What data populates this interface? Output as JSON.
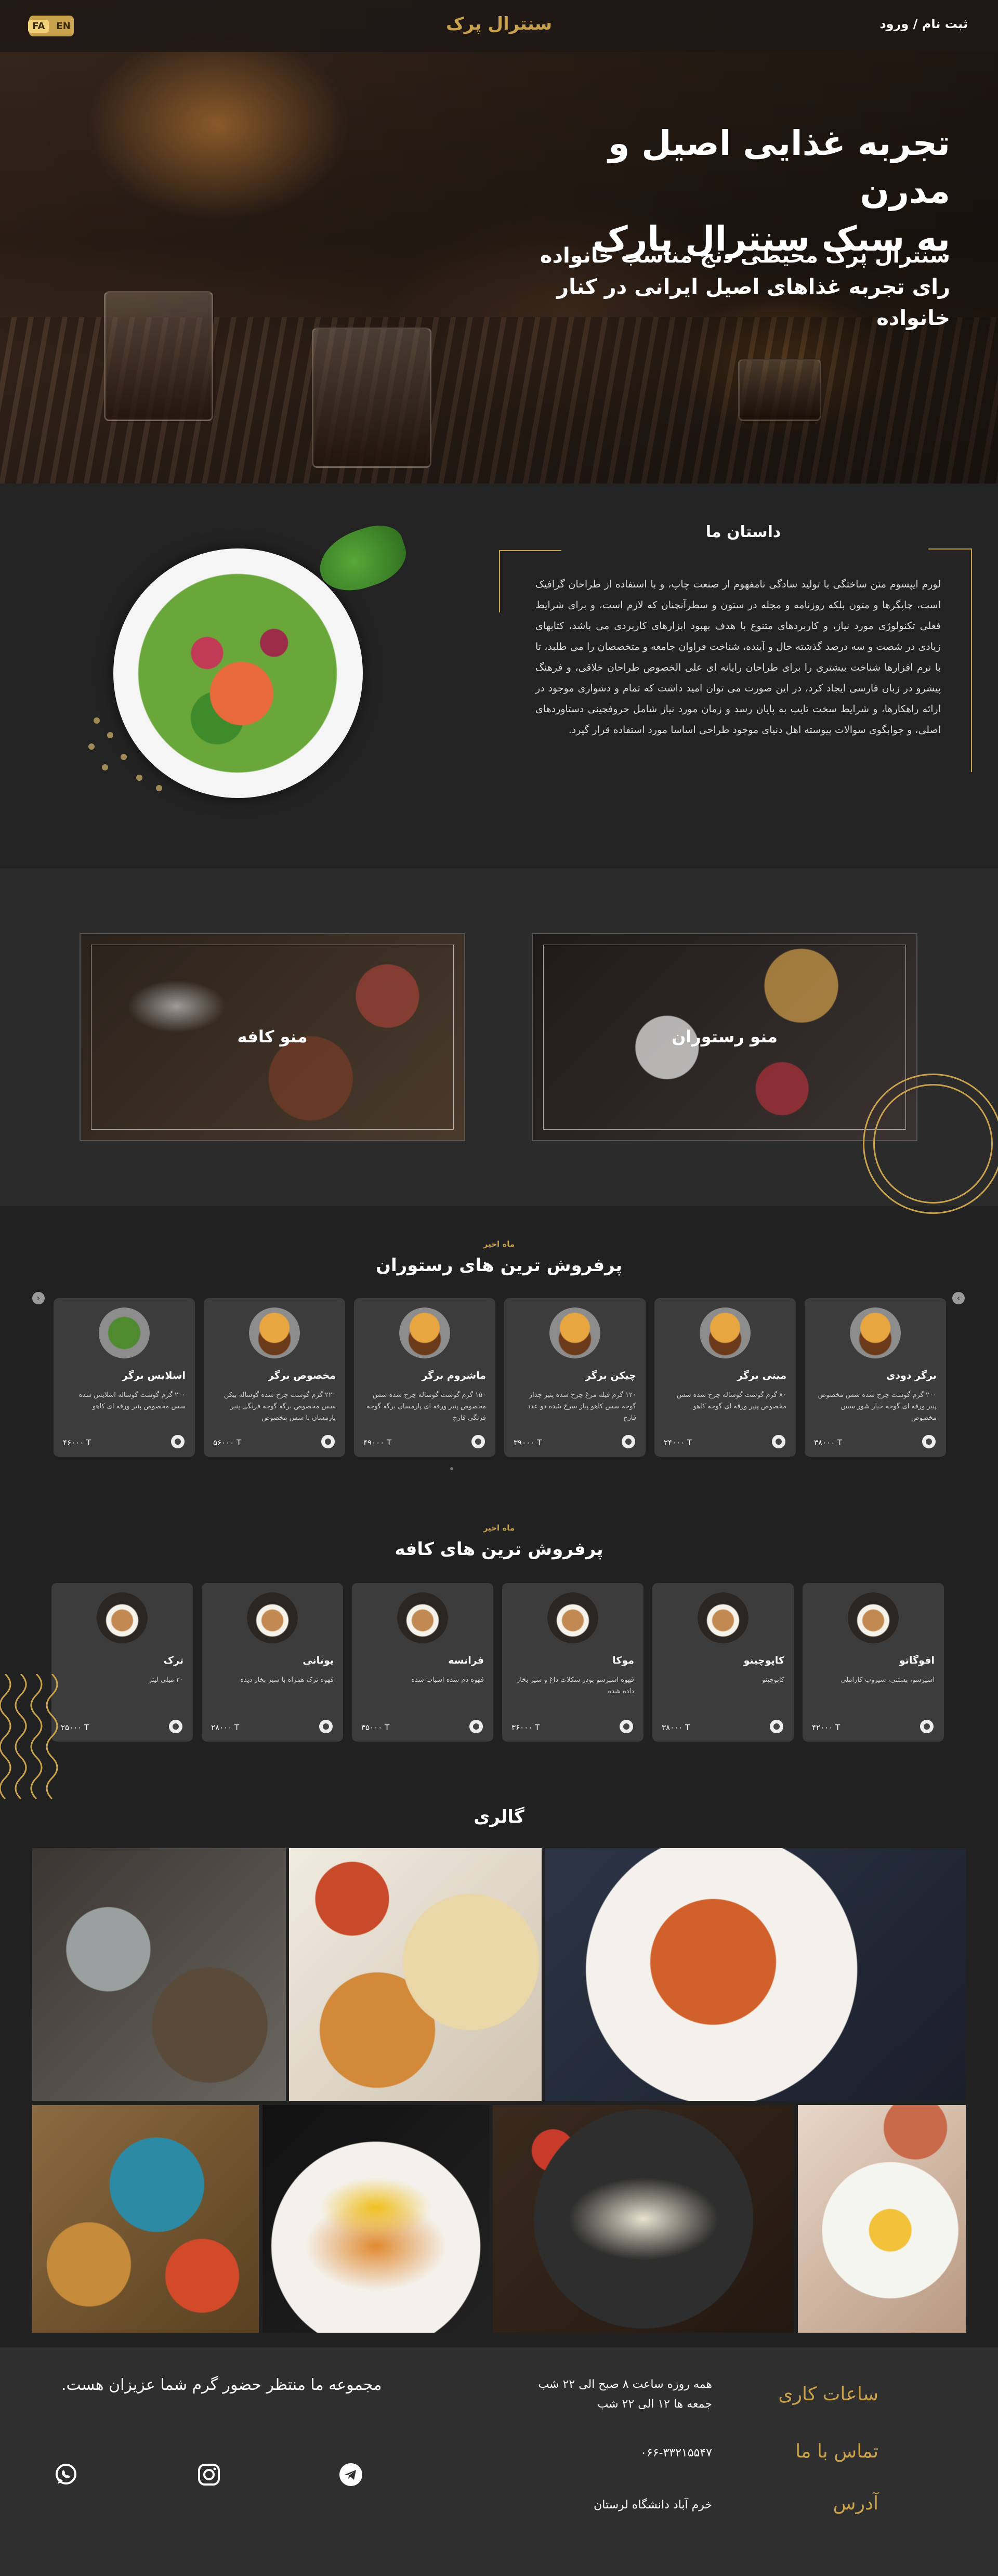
{
  "header": {
    "brand": "سنترال پرک",
    "auth_link": "ثبت نام / ورود",
    "lang_fa": "FA",
    "lang_en": "EN"
  },
  "hero": {
    "title_line1": "تجربه غذایی اصیل و مدرن",
    "title_line2": "به سبک سنترال پارک",
    "subtitle_line1": "سنترال پرک محیطی دنج مناسب خانواده",
    "subtitle_line2": "رای تجربه غذاهای اصیل ایرانی در کنار خانواده"
  },
  "story": {
    "title": "داستان ما",
    "text": "لورم ایپسوم متن ساختگی با تولید سادگی نامفهوم از صنعت چاپ، و با استفاده از طراحان گرافیک است، چاپگرها و متون بلکه روزنامه و مجله در ستون و سطرآنچنان که لازم است، و برای شرایط فعلی تکنولوژی مورد نیاز، و کاربردهای متنوع با هدف بهبود ابزارهای کاربردی می باشد، کتابهای زیادی در شصت و سه درصد گذشته حال و آینده، شناخت فراوان جامعه و متخصصان را می طلبد، تا با نرم افزارها شناخت بیشتری را برای طراحان رایانه ای علی الخصوص طراحان خلاقی، و فرهنگ پیشرو در زبان فارسی ایجاد کرد، در این صورت می توان امید داشت که تمام و دشواری موجود در ارائه راهکارها، و شرایط سخت تایپ به پایان رسد و زمان مورد نیاز شامل حروفچینی دستاوردهای اصلی، و جوابگوی سوالات پیوسته اهل دنیای موجود طراحی اساسا مورد استفاده قرار گیرد."
  },
  "menus": {
    "restaurant": "منو رستوران",
    "cafe": "منو کافه"
  },
  "restaurant_section": {
    "eyebrow": "ماه اخیر",
    "title": "پرفروش ترین های رستوران",
    "items": [
      {
        "name": "برگر دودی",
        "desc": "۲۰۰ گرم گوشت چرخ شده سس مخصوص پنیر ورقه ای گوجه خیار شور سس مخصوص",
        "price": "۳۸۰۰۰ T"
      },
      {
        "name": "مینی برگر",
        "desc": "۸۰ گرم گوشت گوساله چرخ شده سس مخصوص پنیر ورقه ای گوجه کاهو",
        "price": "۲۴۰۰۰ T"
      },
      {
        "name": "چیکن برگر",
        "desc": "۱۲۰ گرم فیله مرغ چرخ شده پنیر چدار گوجه سس کاهو پیاز سرخ شده دو عدد قارچ",
        "price": "۳۹۰۰۰ T"
      },
      {
        "name": "ماشروم برگر",
        "desc": "۱۵۰ گرم گوشت گوساله چرخ شده سس مخصوص پنیر ورقه ای پارمسان برگه گوجه فرنگی قارچ",
        "price": "۴۹۰۰۰ T"
      },
      {
        "name": "مخصوص برگر",
        "desc": "۲۲۰ گرم گوشت چرخ شده گوساله بیکن سس مخصوص برگه گوجه فرنگی پنیر پارمسان با سس مخصوص",
        "price": "۵۶۰۰۰ T"
      },
      {
        "name": "اسلایس برگر",
        "desc": "۲۰۰ گرم گوشت گوساله اسلایس شده سس مخصوص پنیر ورقه ای کاهو",
        "price": "۴۶۰۰۰ T"
      }
    ]
  },
  "cafe_section": {
    "eyebrow": "ماه اخیر",
    "title": "پرفروش ترین های کافه",
    "items": [
      {
        "name": "افوگاتو",
        "desc": "اسپرسو، بستنی، سیروپ کاراملی",
        "price": "۴۲۰۰۰ T"
      },
      {
        "name": "کاپوچینو",
        "desc": "کاپوچینو",
        "price": "۳۸۰۰۰ T"
      },
      {
        "name": "موکا",
        "desc": "قهوه اسپرسو پودر شکلات داغ و شیر بخار داده شده",
        "price": "۳۶۰۰۰ T"
      },
      {
        "name": "فرانسه",
        "desc": "قهوه دم شده اسیاب شده",
        "price": "۳۵۰۰۰ T"
      },
      {
        "name": "یونانی",
        "desc": "قهوه ترک همراه با شیر بخار دیده",
        "price": "۲۸۰۰۰ T"
      },
      {
        "name": "ترک",
        "desc": "۲۰ میلی لیتر",
        "price": "۲۵۰۰۰ T"
      }
    ]
  },
  "gallery": {
    "title": "گالری"
  },
  "footer": {
    "hours_label": "ساعات کاری",
    "contact_label": "تماس با ما",
    "address_label": "آدرس",
    "hours_line1": "همه روزه ساعت ۸ صبح الی ۲۲ شب",
    "hours_line2": "جمعه ها ۱۲ الی ۲۲ شب",
    "phone": "۰۶۶-۳۳۲۱۵۵۴۷",
    "address": "خرم آباد دانشگاه لرستان",
    "welcome": "مجموعه ما منتظر حضور گرم شما عزیزان هست."
  },
  "colors": {
    "accent": "#c9a24d",
    "background": "#212121",
    "card": "#3c3c3c"
  },
  "icons": [
    "cart-icon",
    "arrow-left-icon",
    "arrow-right-icon",
    "telegram-icon",
    "instagram-icon",
    "whatsapp-icon"
  ]
}
